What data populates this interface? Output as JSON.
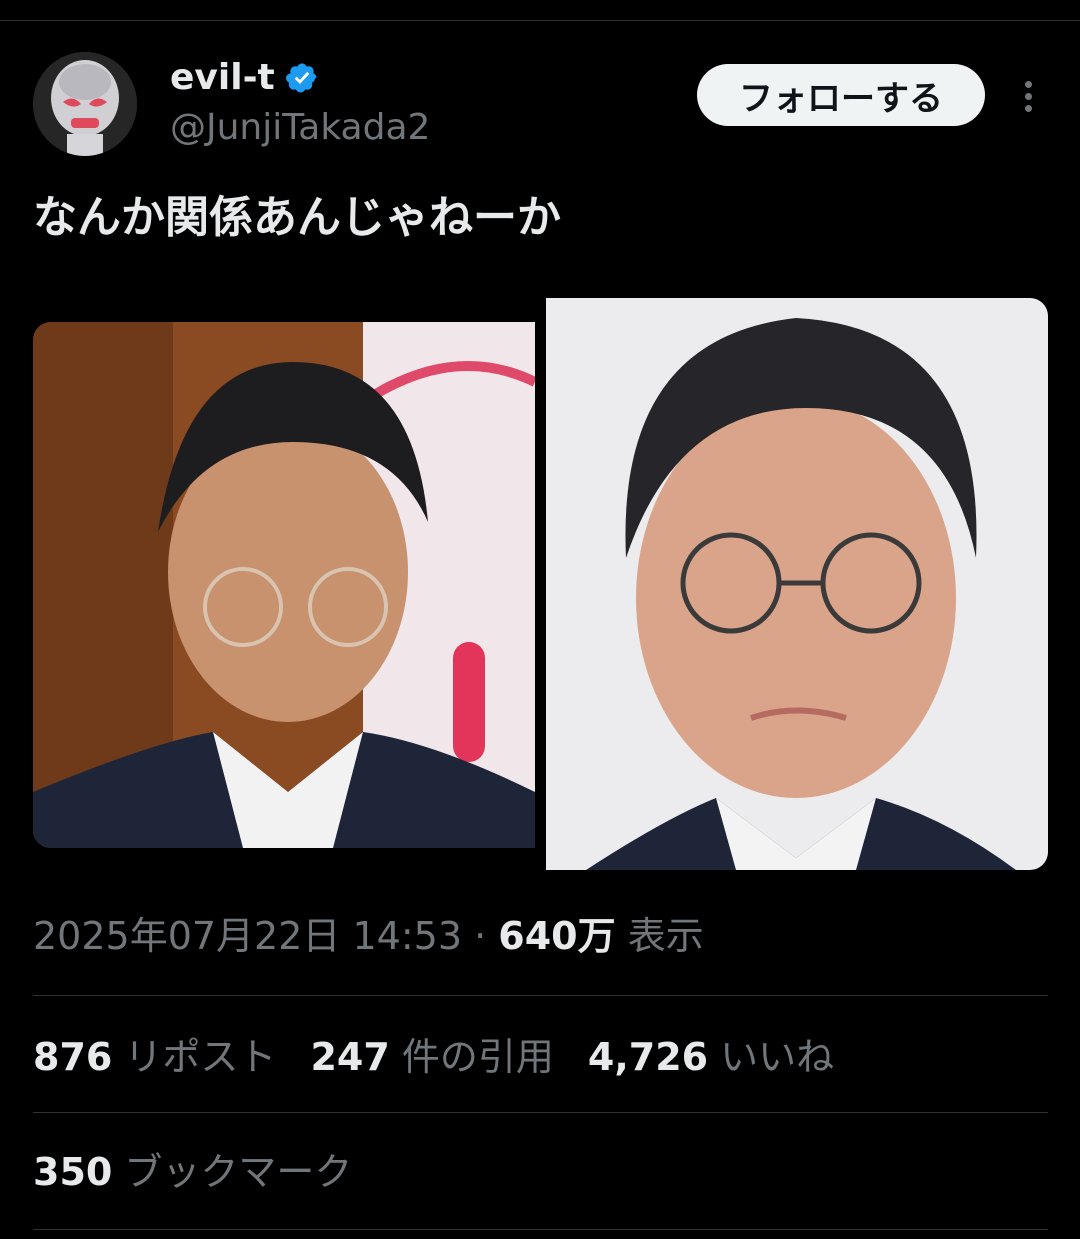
{
  "author": {
    "display_name": "evil-t",
    "handle": "@JunjiTakada2",
    "verified": true,
    "verified_color": "#1d9bf0"
  },
  "actions": {
    "follow_label": "フォローする"
  },
  "tweet": {
    "text": "なんか関係あんじゃねーか"
  },
  "meta": {
    "timestamp": "2025年07月22日 14:53",
    "separator": "·",
    "views_count": "640万",
    "views_label": "表示"
  },
  "stats": {
    "reposts_count": "876",
    "reposts_label": "リポスト",
    "quotes_count": "247",
    "quotes_label": "件の引用",
    "likes_count": "4,726",
    "likes_label": "いいね",
    "bookmarks_count": "350",
    "bookmarks_label": "ブックマーク"
  },
  "colors": {
    "background": "#000000",
    "primary_text": "#e7e9ea",
    "secondary_text": "#71767b",
    "divider": "#2f3336",
    "follow_button_bg": "#eff3f4"
  }
}
